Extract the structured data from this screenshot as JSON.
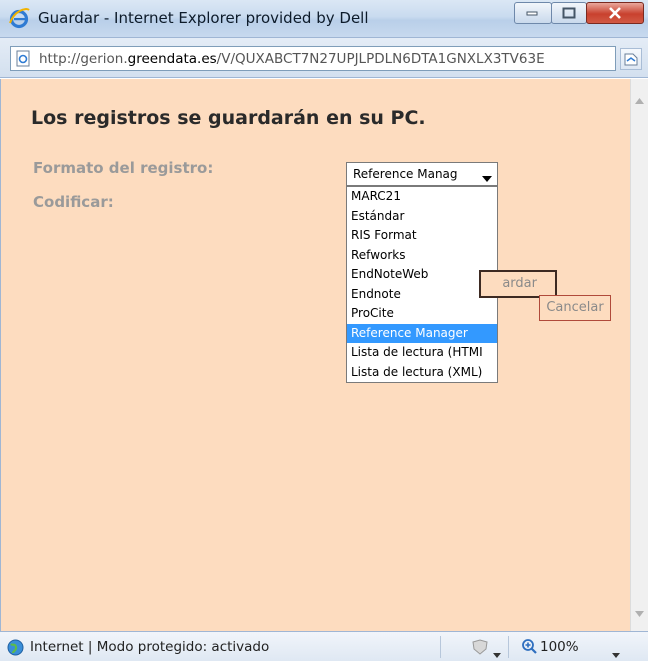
{
  "window": {
    "title": "Guardar - Internet Explorer provided by Dell"
  },
  "address": {
    "url_prefix": "http://gerion.",
    "url_domain": "greendata.es",
    "url_path": "/V/QUXABCT7N27UPJLPDLN6DTA1GNXLX3TV63E"
  },
  "page": {
    "heading": "Los registros se guardarán en su PC.",
    "format_label": "Formato del registro:",
    "encode_label": "Codificar:",
    "select_value": "Reference Manag",
    "options": [
      "MARC21",
      "Estándar",
      "RIS Format",
      "Refworks",
      "EndNoteWeb",
      "Endnote",
      "ProCite",
      "Reference Manager",
      "Lista de lectura (HTMI",
      "Lista de lectura (XML)"
    ],
    "selected_option": "Reference Manager",
    "save_label": "ardar",
    "cancel_label": "Cancelar"
  },
  "status": {
    "zone_text": "Internet | Modo protegido: activado",
    "zoom": "100%"
  },
  "colors": {
    "content_bg": "#fddcbf",
    "selected_bg": "#3399ff"
  }
}
